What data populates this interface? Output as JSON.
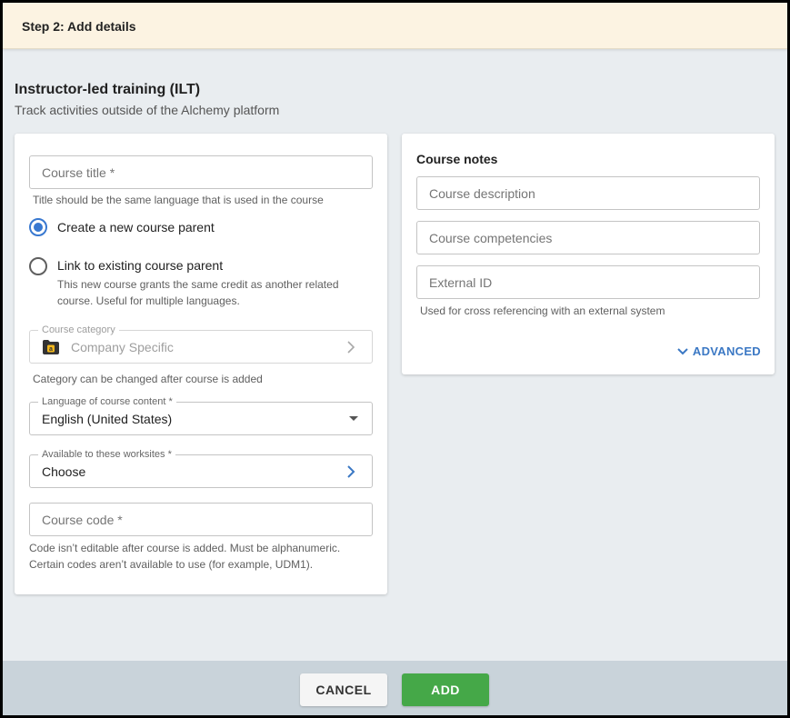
{
  "step": {
    "title": "Step 2: Add details"
  },
  "page": {
    "title": "Instructor-led training (ILT)",
    "subtitle": "Track activities outside of the Alchemy platform"
  },
  "form": {
    "course_title": {
      "placeholder": "Course title *",
      "helper": "Title should be the same language that is used in the course"
    },
    "parent_options": {
      "create": {
        "label": "Create a new course parent",
        "selected": true
      },
      "link": {
        "label": "Link to existing course parent",
        "description": "This new course grants the same credit as another related course. Useful for multiple languages.",
        "selected": false
      }
    },
    "category": {
      "label": "Course category",
      "value": "Company Specific",
      "helper": "Category can be changed after course is added",
      "icon": "folder-icon"
    },
    "language": {
      "label": "Language of course content *",
      "value": "English (United States)"
    },
    "worksites": {
      "label": "Available to these worksites *",
      "value": "Choose"
    },
    "course_code": {
      "placeholder": "Course code *",
      "helper_line1": "Code isn’t editable after course is added. Must be alphanumeric.",
      "helper_line2": "Certain codes aren’t available to use (for example, UDM1)."
    }
  },
  "notes": {
    "title": "Course notes",
    "description": {
      "placeholder": "Course description"
    },
    "competencies": {
      "placeholder": "Course competencies"
    },
    "external_id": {
      "placeholder": "External ID",
      "helper": "Used for cross referencing with an external system"
    },
    "advanced_label": "ADVANCED"
  },
  "footer": {
    "cancel_label": "CANCEL",
    "add_label": "ADD"
  },
  "colors": {
    "accent": "#3878d0",
    "add_button": "#45a848",
    "step_bar": "#fcf3e2",
    "background": "#e9edf0"
  }
}
